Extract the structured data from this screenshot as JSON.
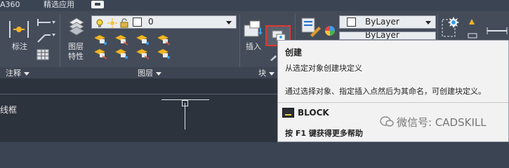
{
  "tabs": [
    {
      "label": "A360"
    },
    {
      "label": "精选应用"
    }
  ],
  "panels": {
    "annotation": {
      "title": "注释",
      "label_button": "标注"
    },
    "layers": {
      "title": "图层",
      "properties_button_line1": "图层",
      "properties_button_line2": "特性",
      "layer_combo_value": "0"
    },
    "block": {
      "title": "块",
      "insert_button": "插入"
    },
    "properties": {
      "color_combo_value": "ByLayer",
      "linetype_combo_partial": "ByLayer"
    }
  },
  "tooltip": {
    "title": "创建",
    "description": "从选定对象创建块定义",
    "detail": "通过选择对象、指定插入点然后为其命名，可创建块定义。",
    "command": "BLOCK",
    "help": "按 F1 键获得更多帮助"
  },
  "drawing": {
    "viewport_label": "线框"
  },
  "watermark": "微信号: CADSKILL",
  "colors": {
    "accent_outline": "#e0382f",
    "ribbon_bg": "#444c5a",
    "drawing_bg": "#2d333d",
    "tooltip_bg": "#f2f2f2"
  }
}
